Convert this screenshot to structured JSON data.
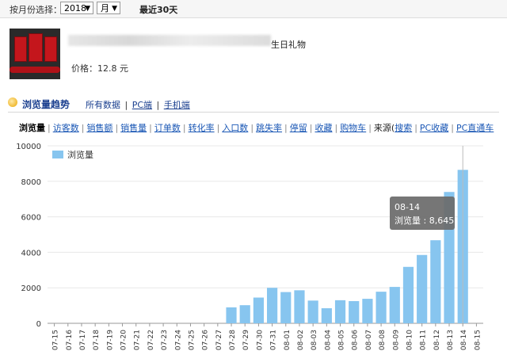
{
  "toolbar": {
    "month_label": "按月份选择：",
    "year_value": "2018",
    "month_value": "月",
    "recent_label": "最近30天"
  },
  "product": {
    "name_visible": "生日礼物",
    "price_label": "价格：12.8 元"
  },
  "section": {
    "title": "浏览量趋势",
    "tabs": [
      "所有数据",
      "PC端",
      "手机端"
    ]
  },
  "metrics": {
    "items": [
      "浏览量",
      "访客数",
      "销售额",
      "销售量",
      "订单数",
      "转化率",
      "入口数",
      "跳失率",
      "停留",
      "收藏",
      "购物车"
    ],
    "source_label": "来源(",
    "source_items": [
      "搜索",
      "PC收藏",
      "PC直通车"
    ],
    "colors": {
      "link": "#1a57b5",
      "bar": "#87c5ef"
    }
  },
  "chart_data": {
    "type": "bar",
    "categories": [
      "07-15",
      "07-16",
      "07-17",
      "07-18",
      "07-19",
      "07-20",
      "07-21",
      "07-22",
      "07-23",
      "07-24",
      "07-25",
      "07-26",
      "07-27",
      "07-28",
      "07-29",
      "07-30",
      "07-31",
      "08-01",
      "08-02",
      "08-03",
      "08-04",
      "08-05",
      "08-06",
      "08-07",
      "08-08",
      "08-09",
      "08-10",
      "08-11",
      "08-12",
      "08-13",
      "08-14",
      "08-15"
    ],
    "series": [
      {
        "name": "浏览量",
        "values": [
          0,
          0,
          0,
          0,
          0,
          0,
          0,
          0,
          0,
          0,
          0,
          0,
          0,
          900,
          1020,
          1450,
          2000,
          1760,
          1860,
          1280,
          850,
          1300,
          1250,
          1380,
          1780,
          2050,
          3180,
          3850,
          4680,
          7400,
          8645,
          0
        ]
      }
    ],
    "ylim": [
      0,
      10000
    ],
    "yticks": [
      0,
      2000,
      4000,
      6000,
      8000,
      10000
    ],
    "grid": true,
    "legend": "top-left",
    "tooltip": {
      "date": "08-14",
      "text": "浏览量 : 8,645"
    }
  }
}
